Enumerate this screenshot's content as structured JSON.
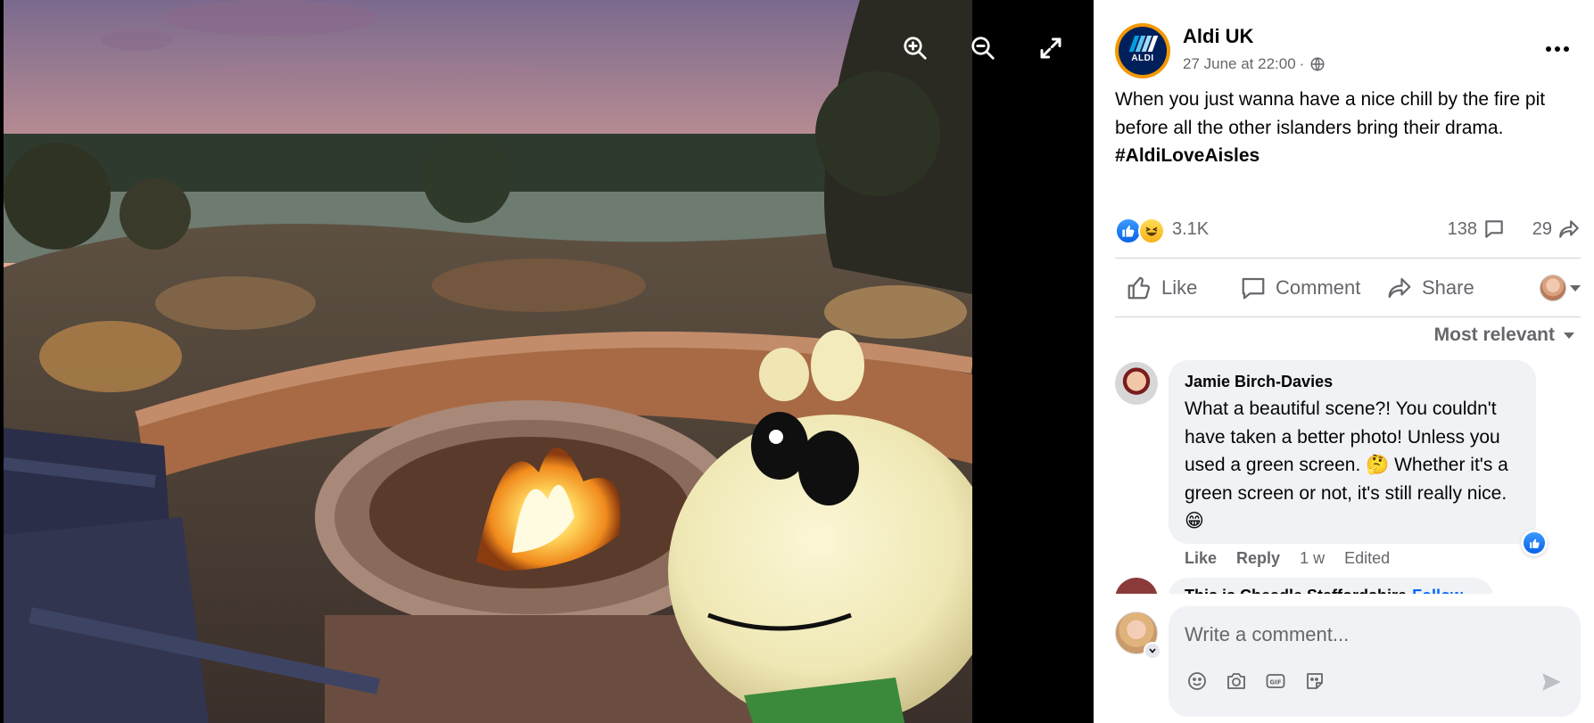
{
  "viewer": {
    "controls": [
      "zoom-in-icon",
      "zoom-out-icon",
      "fullscreen-icon"
    ]
  },
  "post": {
    "page_name": "Aldi UK",
    "avatar_text": "ALDI",
    "timestamp": "27 June at 22:00",
    "meta_separator": "·",
    "caption": "When you just wanna have a nice chill by the fire pit before all the other islanders bring their drama. ",
    "hashtag": "#AldiLoveAisles",
    "reactions_count": "3.1K",
    "comments_count": "138",
    "shares_count": "29",
    "actions": {
      "like": "Like",
      "comment": "Comment",
      "share": "Share"
    },
    "sort_label": "Most relevant"
  },
  "comments": [
    {
      "author": "Jamie Birch-Davies",
      "text": "What a beautiful scene?! You couldn't have taken a better photo! Unless you used a green screen. 🤔 Whether it's a green screen or not, it's still really nice. 😁",
      "like_label": "Like",
      "reply_label": "Reply",
      "age": "1 w",
      "edited": "Edited"
    },
    {
      "author": "This is Cheadle Staffordshire",
      "follow": "Follow"
    }
  ],
  "composer": {
    "placeholder": "Write a comment..."
  },
  "colors": {
    "accent_blue": "#0866ff",
    "aldi_navy": "#00205b",
    "aldi_orange": "#f39800",
    "secondary_text": "#65676b",
    "bubble_bg": "#f0f2f5"
  }
}
